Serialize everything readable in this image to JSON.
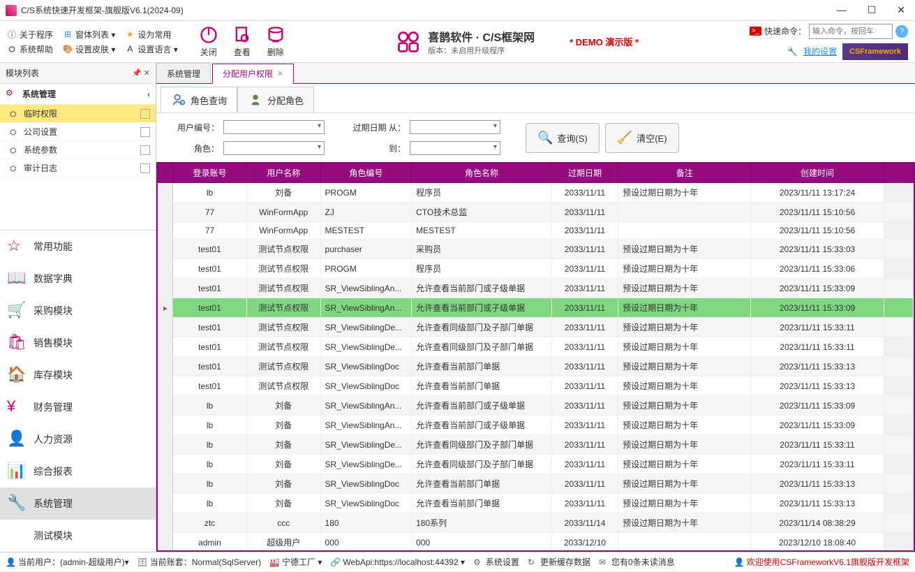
{
  "window": {
    "title": "C/S系统快速开发框架-旗舰版V6.1(2024-09)"
  },
  "ribbon": {
    "links_row1": [
      "关于程序",
      "窗体列表 ▾",
      "设为常用"
    ],
    "links_row2": [
      "系统帮助",
      "设置皮肤 ▾",
      "设置语言 ▾"
    ],
    "actions": [
      {
        "label": "关闭"
      },
      {
        "label": "查看"
      },
      {
        "label": "删除"
      }
    ],
    "brand_title": "喜鹊软件 · C/S框架网",
    "brand_sub": "版本：未启用升级程序",
    "demo": "* DEMO 演示版 *",
    "quick_label": "快速命令：",
    "quick_placeholder": "输入命令，按回车",
    "settings_link": "我的设置",
    "cs_badge": "CSFramework"
  },
  "sidebar": {
    "header": "模块列表",
    "section": "系统管理",
    "items": [
      "临时权限",
      "公司设置",
      "系统参数",
      "审计日志"
    ],
    "bignav": [
      "常用功能",
      "数据字典",
      "采购模块",
      "销售模块",
      "库存模块",
      "财务管理",
      "人力资源",
      "综合报表",
      "系统管理",
      "测试模块"
    ]
  },
  "tabs": {
    "docs": [
      "系统管理",
      "分配用户权限"
    ],
    "subs": [
      "角色查询",
      "分配角色"
    ]
  },
  "search": {
    "user_no": "用户编号：",
    "role": "角色：",
    "exp_from": "过期日期 从：",
    "to": "到：",
    "query": "查询(S)",
    "clear": "清空(E)"
  },
  "grid": {
    "headers": [
      "登录账号",
      "用户名称",
      "角色编号",
      "角色名称",
      "过期日期",
      "备注",
      "创建时间"
    ],
    "rows": [
      [
        "lb",
        "刘备",
        "PROGM",
        "程序员",
        "2033/11/11",
        "预设过期日期为十年",
        "2023/11/11 13:17:24"
      ],
      [
        "77",
        "WinFormApp",
        "ZJ",
        "CTO技术总监",
        "2033/11/11",
        "",
        "2023/11/11 15:10:56"
      ],
      [
        "77",
        "WinFormApp",
        "MESTEST",
        "MESTEST",
        "2033/11/11",
        "",
        "2023/11/11 15:10:56"
      ],
      [
        "test01",
        "测试节点权限",
        "purchaser",
        "采购员",
        "2033/11/11",
        "预设过期日期为十年",
        "2023/11/11 15:33:03"
      ],
      [
        "test01",
        "测试节点权限",
        "PROGM",
        "程序员",
        "2033/11/11",
        "预设过期日期为十年",
        "2023/11/11 15:33:06"
      ],
      [
        "test01",
        "测试节点权限",
        "SR_ViewSiblingAn...",
        "允许查看当前部门或子级单据",
        "2033/11/11",
        "预设过期日期为十年",
        "2023/11/11 15:33:09"
      ],
      [
        "test01",
        "测试节点权限",
        "SR_ViewSiblingAn...",
        "允许查看当前部门或子级单据",
        "2033/11/11",
        "预设过期日期为十年",
        "2023/11/11 15:33:09"
      ],
      [
        "test01",
        "测试节点权限",
        "SR_ViewSiblingDe...",
        "允许查看同级部门及子部门单据",
        "2033/11/11",
        "预设过期日期为十年",
        "2023/11/11 15:33:11"
      ],
      [
        "test01",
        "测试节点权限",
        "SR_ViewSiblingDe...",
        "允许查看同级部门及子部门单据",
        "2033/11/11",
        "预设过期日期为十年",
        "2023/11/11 15:33:11"
      ],
      [
        "test01",
        "测试节点权限",
        "SR_ViewSiblingDoc",
        "允许查看当前部门单据",
        "2033/11/11",
        "预设过期日期为十年",
        "2023/11/11 15:33:13"
      ],
      [
        "test01",
        "测试节点权限",
        "SR_ViewSiblingDoc",
        "允许查看当前部门单据",
        "2033/11/11",
        "预设过期日期为十年",
        "2023/11/11 15:33:13"
      ],
      [
        "lb",
        "刘备",
        "SR_ViewSiblingAn...",
        "允许查看当前部门或子级单据",
        "2033/11/11",
        "预设过期日期为十年",
        "2023/11/11 15:33:09"
      ],
      [
        "lb",
        "刘备",
        "SR_ViewSiblingAn...",
        "允许查看当前部门或子级单据",
        "2033/11/11",
        "预设过期日期为十年",
        "2023/11/11 15:33:09"
      ],
      [
        "lb",
        "刘备",
        "SR_ViewSiblingDe...",
        "允许查看同级部门及子部门单据",
        "2033/11/11",
        "预设过期日期为十年",
        "2023/11/11 15:33:11"
      ],
      [
        "lb",
        "刘备",
        "SR_ViewSiblingDe...",
        "允许查看同级部门及子部门单据",
        "2033/11/11",
        "预设过期日期为十年",
        "2023/11/11 15:33:11"
      ],
      [
        "lb",
        "刘备",
        "SR_ViewSiblingDoc",
        "允许查看当前部门单据",
        "2033/11/11",
        "预设过期日期为十年",
        "2023/11/11 15:33:13"
      ],
      [
        "lb",
        "刘备",
        "SR_ViewSiblingDoc",
        "允许查看当前部门单据",
        "2033/11/11",
        "预设过期日期为十年",
        "2023/11/11 15:33:13"
      ],
      [
        "ztc",
        "ccc",
        "180",
        "180系列",
        "2033/11/14",
        "预设过期日期为十年",
        "2023/11/14 08:38:29"
      ],
      [
        "admin",
        "超级用户",
        "000",
        "000",
        "2033/12/10",
        "",
        "2023/12/10 18:08:40"
      ]
    ],
    "selected": 6
  },
  "status": {
    "user": "当前用户：(admin-超级用户)▾",
    "acct": "当前账套：Normal(SqlServer)",
    "factory": "宁德工厂 ▾",
    "webapi": "WebApi:https://localhost:44392 ▾",
    "sys": "系统设置",
    "cache": "更新缓存数据",
    "msg": "您有0条未读消息",
    "welcome": "欢迎使用CSFrameworkV6.1旗舰版开发框架"
  }
}
